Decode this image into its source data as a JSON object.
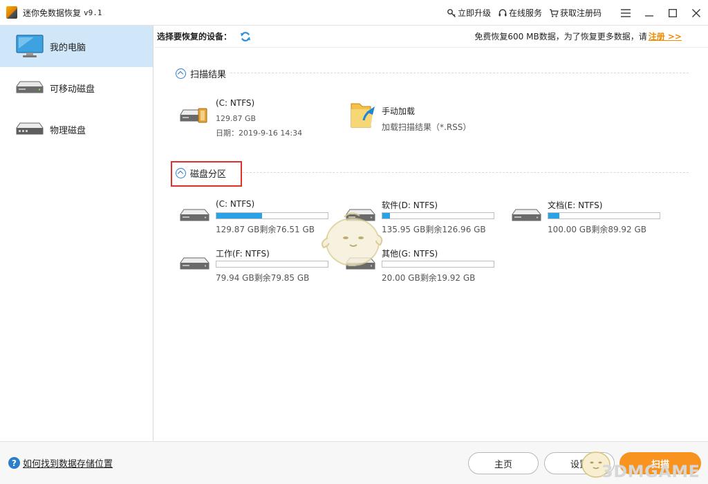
{
  "titlebar": {
    "title": "迷你免数据恢复",
    "version": "v9.1",
    "links": {
      "upgrade": "立即升级",
      "online_service": "在线服务",
      "get_code": "获取注册码"
    }
  },
  "sidebar": {
    "items": [
      {
        "label": "我的电脑",
        "icon": "monitor-icon",
        "active": true
      },
      {
        "label": "可移动磁盘",
        "icon": "removable-disk-icon",
        "active": false
      },
      {
        "label": "物理磁盘",
        "icon": "physical-disk-icon",
        "active": false
      }
    ]
  },
  "devbar": {
    "label": "选择要恢复的设备：",
    "free_note": "免费恢复600 MB数据，为了恢复更多数据，请",
    "register_link": "注册 >>"
  },
  "scan_results": {
    "title": "扫描结果",
    "entry": {
      "name": "(C: NTFS)",
      "size": "129.87 GB",
      "date": "日期：2019-9-16 14:34"
    },
    "manual": {
      "name": "手动加载",
      "desc": "加载扫描结果（*.RSS）"
    }
  },
  "partitions": {
    "title": "磁盘分区",
    "items": [
      {
        "name": "(C: NTFS)",
        "usage": "129.87 GB剩余76.51 GB",
        "used_fraction": 0.41
      },
      {
        "name": "软件(D: NTFS)",
        "usage": "135.95 GB剩余126.96 GB",
        "used_fraction": 0.07
      },
      {
        "name": "文档(E: NTFS)",
        "usage": "100.00 GB剩余89.92 GB",
        "used_fraction": 0.1
      },
      {
        "name": "工作(F: NTFS)",
        "usage": "79.94 GB剩余79.85 GB",
        "used_fraction": 0.0
      },
      {
        "name": "其他(G: NTFS)",
        "usage": "20.00 GB剩余19.92 GB",
        "used_fraction": 0.0
      }
    ]
  },
  "footer": {
    "help_text": "如何找到数据存储位置",
    "home_button": "主页",
    "settings_button": "设置",
    "scan_button": "扫描"
  },
  "watermark": {
    "text": "3DMGAME"
  },
  "colors": {
    "accent": "#29a3e6",
    "active_nav": "#cfe7f8",
    "primary_button": "#f7931e",
    "register_link": "#f28a00",
    "highlight": "#e0302a"
  }
}
